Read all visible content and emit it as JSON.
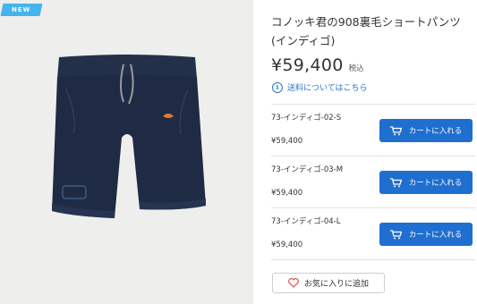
{
  "product": {
    "badge": "NEW",
    "title": "コノッキ君の908裏毛ショートパンツ(インディゴ)",
    "price": "¥59,400",
    "tax_label": "税込",
    "shipping_link": "送料についてはこちら"
  },
  "variants": [
    {
      "sku": "73-インディゴ-02-S",
      "price": "¥59,400",
      "button": "カートに入れる"
    },
    {
      "sku": "73-インディゴ-03-M",
      "price": "¥59,400",
      "button": "カートに入れる"
    },
    {
      "sku": "73-インディゴ-04-L",
      "price": "¥59,400",
      "button": "カートに入れる"
    }
  ],
  "favorite": {
    "label": "お気に入りに追加"
  },
  "icons": {
    "info": "info-icon",
    "cart": "cart-icon",
    "heart": "heart-icon"
  },
  "colors": {
    "accent": "#1f6fd1",
    "badge": "#45b4ec",
    "link": "#2c77c9",
    "favorite_heart": "#d9534f"
  }
}
